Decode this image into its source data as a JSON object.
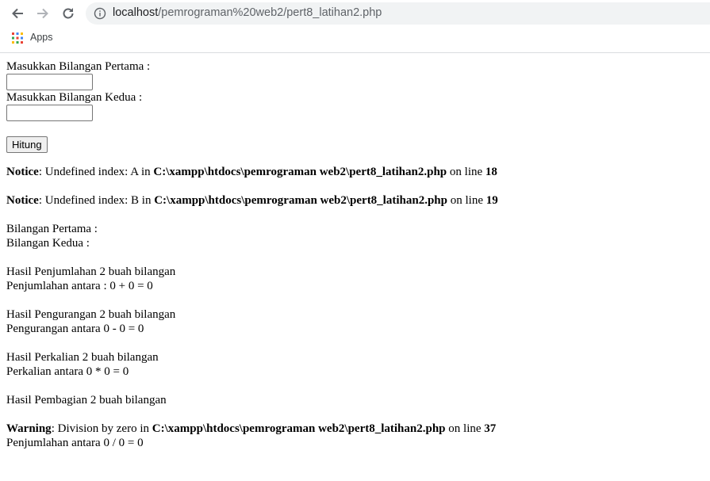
{
  "browser": {
    "url_host": "localhost",
    "url_path": "/pemrograman%20web2/pert8_latihan2.php",
    "bookmarks": {
      "apps_label": "Apps"
    }
  },
  "form": {
    "label_first": "Masukkan Bilangan Pertama :",
    "input_first_value": "",
    "label_second": "Masukkan Bilangan Kedua :",
    "input_second_value": "",
    "submit_label": "Hitung"
  },
  "notices": [
    {
      "type": "Notice",
      "message": ": Undefined index: A in ",
      "file": "C:\\xampp\\htdocs\\pemrograman web2\\pert8_latihan2.php",
      "on_line_text": " on line ",
      "line": "18"
    },
    {
      "type": "Notice",
      "message": ": Undefined index: B in ",
      "file": "C:\\xampp\\htdocs\\pemrograman web2\\pert8_latihan2.php",
      "on_line_text": " on line ",
      "line": "19"
    }
  ],
  "results": {
    "first_label": "Bilangan Pertama :",
    "second_label": "Bilangan Kedua :",
    "add_title": "Hasil Penjumlahan 2 buah bilangan",
    "add_line": "Penjumlahan antara : 0 + 0 = 0",
    "sub_title": "Hasil Pengurangan 2 buah bilangan",
    "sub_line": "Pengurangan antara 0 - 0 = 0",
    "mul_title": "Hasil Perkalian 2 buah bilangan",
    "mul_line": "Perkalian antara 0 * 0 = 0",
    "div_title": "Hasil Pembagian 2 buah bilangan",
    "div_line": "Penjumlahan antara 0 / 0 = 0"
  },
  "warning": {
    "type": "Warning",
    "message": ": Division by zero in ",
    "file": "C:\\xampp\\htdocs\\pemrograman web2\\pert8_latihan2.php",
    "on_line_text": " on line ",
    "line": "37"
  }
}
